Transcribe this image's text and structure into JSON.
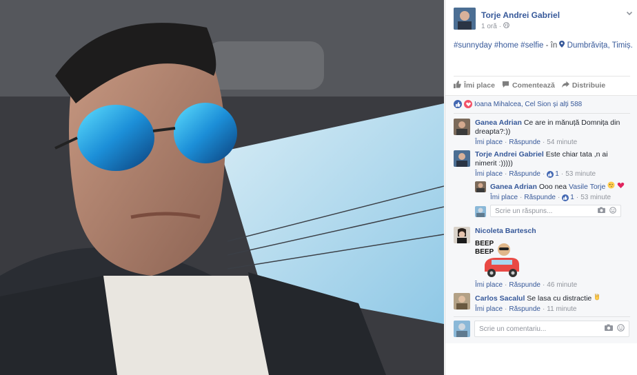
{
  "post": {
    "author": "Torje Andrei Gabriel",
    "time": "1 oră",
    "privacy_icon": "globe-icon",
    "caption_tags": "#sunnyday #home #selfie",
    "caption_in": "- în",
    "location": "Dumbrăvița, Timiș."
  },
  "actions": {
    "like": "Îmi place",
    "comment": "Comentează",
    "share": "Distribuie"
  },
  "reactions": {
    "summary": "Ioana Mihalcea, Cel Sion și alți 588"
  },
  "comments": [
    {
      "author": "Ganea Adrian",
      "text": "Ce are in mănuță Domnița din dreapta?:))",
      "like": "Îmi place",
      "reply": "Răspunde",
      "time": "54 minute"
    },
    {
      "author": "Torje Andrei Gabriel",
      "text": "Este chiar tata ,n ai nimerit :)))))",
      "like": "Îmi place",
      "reply": "Răspunde",
      "likes": "1",
      "time": "53 minute"
    },
    {
      "author": "Nicoleta Bartesch",
      "sticker": "BEEP BEEP",
      "like": "Îmi place",
      "reply": "Răspunde",
      "time": "46 minute"
    },
    {
      "author": "Carlos Sacalul",
      "text": "Se lasa cu distractie",
      "like": "Îmi place",
      "reply": "Răspunde",
      "time": "11 minute"
    }
  ],
  "reply": {
    "author": "Ganea Adrian",
    "text": "Ooo nea",
    "mention": "Vasile Torje",
    "like": "Îmi place",
    "reply": "Răspunde",
    "likes": "1",
    "time": "53 minute"
  },
  "reply_input": {
    "placeholder": "Scrie un răspuns..."
  },
  "comment_input": {
    "placeholder": "Scrie un comentariu..."
  },
  "colors": {
    "link": "#365899",
    "like_blue": "#4267b2",
    "love_red": "#f25268"
  }
}
